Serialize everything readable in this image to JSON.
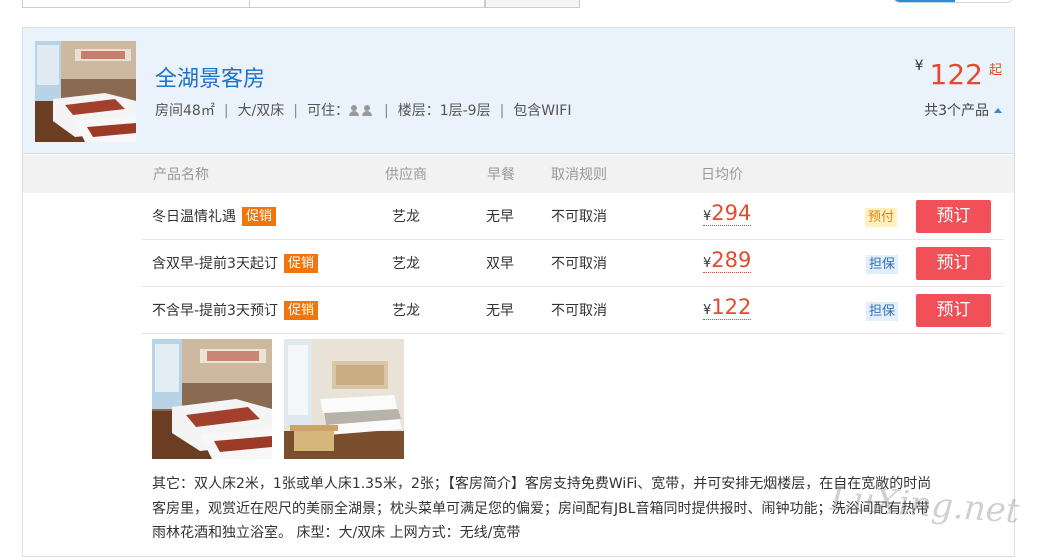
{
  "room": {
    "title": "全湖景客房",
    "area": "房间48㎡",
    "bed": "大/双床",
    "occupancy_label": "可住：",
    "floor": "楼层：1层-9层",
    "wifi": "包含WIFI",
    "price_currency": "¥",
    "price_from": "122",
    "price_suffix": "起",
    "product_count": "共3个产品"
  },
  "table": {
    "headers": [
      "产品名称",
      "供应商",
      "早餐",
      "取消规则",
      "日均价"
    ],
    "rows": [
      {
        "name": "冬日温情礼遇",
        "promo": "促销",
        "supplier": "艺龙",
        "breakfast": "无早",
        "cancel": "不可取消",
        "currency": "¥",
        "price": "294",
        "pay": "预付",
        "pay_type": "prepay",
        "book": "预订"
      },
      {
        "name": "含双早-提前3天起订",
        "promo": "促销",
        "supplier": "艺龙",
        "breakfast": "双早",
        "cancel": "不可取消",
        "currency": "¥",
        "price": "289",
        "pay": "担保",
        "pay_type": "guarantee",
        "book": "预订"
      },
      {
        "name": "不含早-提前3天预订",
        "promo": "促销",
        "supplier": "艺龙",
        "breakfast": "无早",
        "cancel": "不可取消",
        "currency": "¥",
        "price": "122",
        "pay": "担保",
        "pay_type": "guarantee",
        "book": "预订"
      }
    ]
  },
  "description": "其它：双人床2米，1张或单人床1.35米，2张；【客房简介】客房支持免费WiFi、宽带，并可安排无烟楼层，在自在宽敞的时尚客房里，观赏近在咫尺的美丽全湖景；枕头菜单可满足您的偏爱；房间配有JBL音箱同时提供报时、闹钟功能；洗浴间配有热带雨林花酒和独立浴室。 床型：大/双床 上网方式：无线/宽带",
  "watermark": "LuXing.net",
  "colors": {
    "accent": "#1b73c8",
    "price": "#e24b2f",
    "promo": "#f0760b",
    "book": "#f25059"
  }
}
